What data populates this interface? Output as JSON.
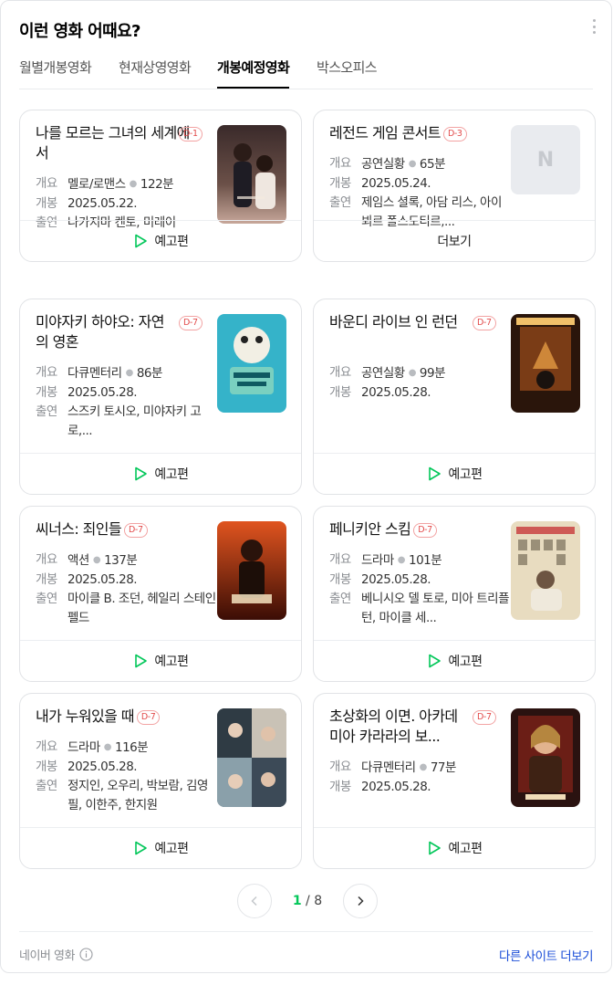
{
  "panel": {
    "title": "이런 영화 어때요?"
  },
  "tabs": [
    {
      "label": "월별개봉영화"
    },
    {
      "label": "현재상영영화"
    },
    {
      "label": "개봉예정영화"
    },
    {
      "label": "박스오피스"
    }
  ],
  "active_tab": "개봉예정영화",
  "info_keys": {
    "genre": "개요",
    "release": "개봉",
    "cast": "출연"
  },
  "accent_color": "#03c75a",
  "dday_color": "#e24b4b",
  "movies": [
    {
      "title": "나를 모르는 그녀의 세계에서",
      "dday": "D-1",
      "genre": "멜로/로맨스",
      "runtime": "122분",
      "release": "2025.05.22.",
      "cast": "나카지마 켄토, 미레이",
      "footer": "예고편"
    },
    {
      "title": "레전드 게임 콘서트",
      "dday": "D-3",
      "genre": "공연실황",
      "runtime": "65분",
      "release": "2025.05.24.",
      "cast": "제임스 셜록, 아담 리스, 아이뵈르 폴스도티르,...",
      "footer": "더보기",
      "poster_placeholder": "N"
    },
    {
      "title": "미야자키 하야오: 자연의 영혼",
      "dday": "D-7",
      "genre": "다큐멘터리",
      "runtime": "86분",
      "release": "2025.05.28.",
      "cast": "스즈키 토시오, 미야자키 고로,...",
      "footer": "예고편"
    },
    {
      "title": "바운디 라이브 인 런던",
      "dday": "D-7",
      "genre": "공연실황",
      "runtime": "99분",
      "release": "2025.05.28.",
      "footer": "예고편"
    },
    {
      "title": "씨너스: 죄인들",
      "dday": "D-7",
      "genre": "액션",
      "runtime": "137분",
      "release": "2025.05.28.",
      "cast": "마이클 B. 조던, 헤일리 스테인펠드",
      "footer": "예고편"
    },
    {
      "title": "페니키안 스킴",
      "dday": "D-7",
      "genre": "드라마",
      "runtime": "101분",
      "release": "2025.05.28.",
      "cast": "베니시오 델 토로, 미아 트리플턴, 마이클 세...",
      "footer": "예고편"
    },
    {
      "title": "내가 누워있을 때",
      "dday": "D-7",
      "genre": "드라마",
      "runtime": "116분",
      "release": "2025.05.28.",
      "cast": "정지인, 오우리, 박보람, 김영필, 이한주, 한지원",
      "footer": "예고편"
    },
    {
      "title": "초상화의 이면. 아카데미아 카라라의 보...",
      "dday": "D-7",
      "genre": "다큐멘터리",
      "runtime": "77분",
      "release": "2025.05.28.",
      "footer": "예고편"
    }
  ],
  "pagination": {
    "current": "1",
    "total": "8",
    "separator": "/"
  },
  "footer": {
    "source": "네이버 영화",
    "more_link": "다른 사이트 더보기"
  }
}
